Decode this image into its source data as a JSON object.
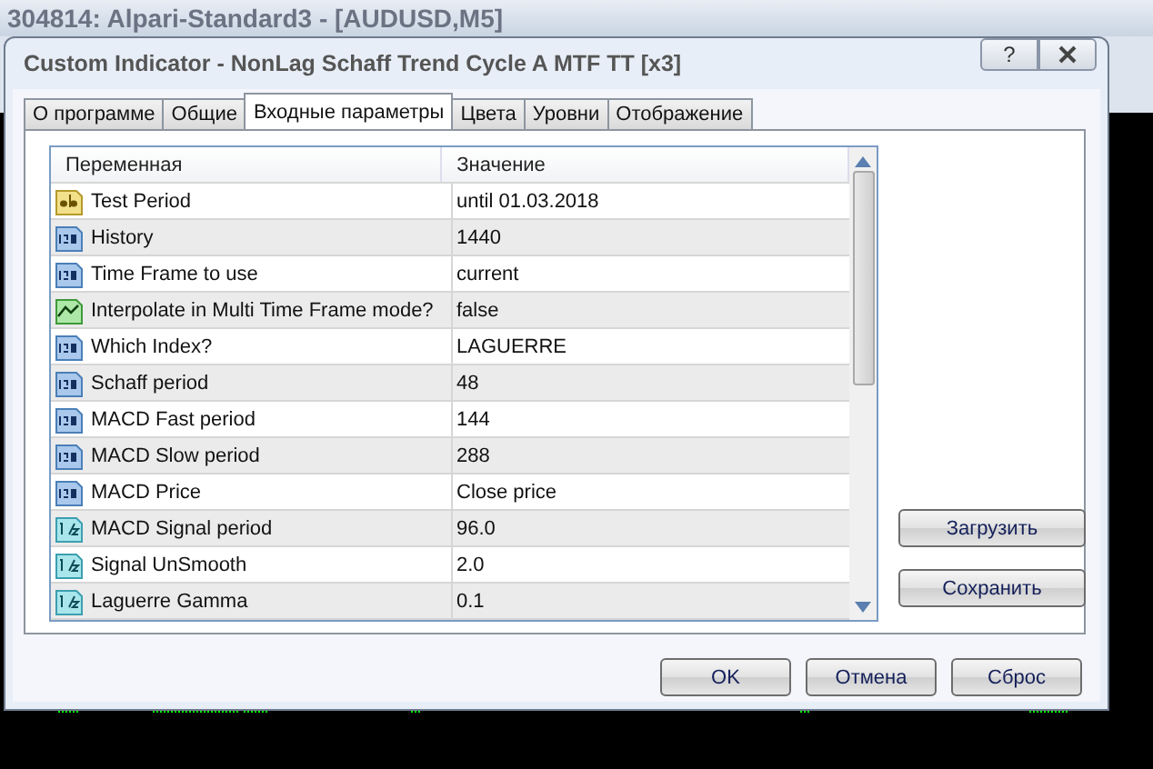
{
  "app_window": {
    "title": "304814: Alpari-Standard3 - [AUDUSD,M5]"
  },
  "dialog": {
    "title": "Custom Indicator - NonLag Schaff Trend Cycle A MTF TT [x3]",
    "help": "?"
  },
  "tabs": [
    {
      "label": "О программе",
      "selected": false
    },
    {
      "label": "Общие",
      "selected": false
    },
    {
      "label": "Входные параметры",
      "selected": true
    },
    {
      "label": "Цвета",
      "selected": false
    },
    {
      "label": "Уровни",
      "selected": false
    },
    {
      "label": "Отображение",
      "selected": false
    }
  ],
  "table": {
    "columns": [
      "Переменная",
      "Значение"
    ],
    "rows": [
      {
        "kind": "string",
        "name": "Test Period",
        "value": "until 01.03.2018"
      },
      {
        "kind": "int",
        "name": "History",
        "value": "1440"
      },
      {
        "kind": "int",
        "name": "Time Frame to use",
        "value": "current"
      },
      {
        "kind": "bool",
        "name": "Interpolate in Multi Time Frame mode?",
        "value": "false"
      },
      {
        "kind": "int",
        "name": "Which Index?",
        "value": "LAGUERRE"
      },
      {
        "kind": "int",
        "name": "Schaff period",
        "value": "48"
      },
      {
        "kind": "int",
        "name": "MACD Fast period",
        "value": "144"
      },
      {
        "kind": "int",
        "name": "MACD Slow period",
        "value": "288"
      },
      {
        "kind": "int",
        "name": "MACD Price",
        "value": "Close price"
      },
      {
        "kind": "double",
        "name": "MACD Signal period",
        "value": "96.0"
      },
      {
        "kind": "double",
        "name": "Signal UnSmooth",
        "value": "2.0"
      },
      {
        "kind": "double",
        "name": "Laguerre Gamma",
        "value": "0.1"
      }
    ]
  },
  "side_buttons": [
    "Загрузить",
    "Сохранить"
  ],
  "buttons": [
    "OK",
    "Отмена",
    "Сброс"
  ]
}
